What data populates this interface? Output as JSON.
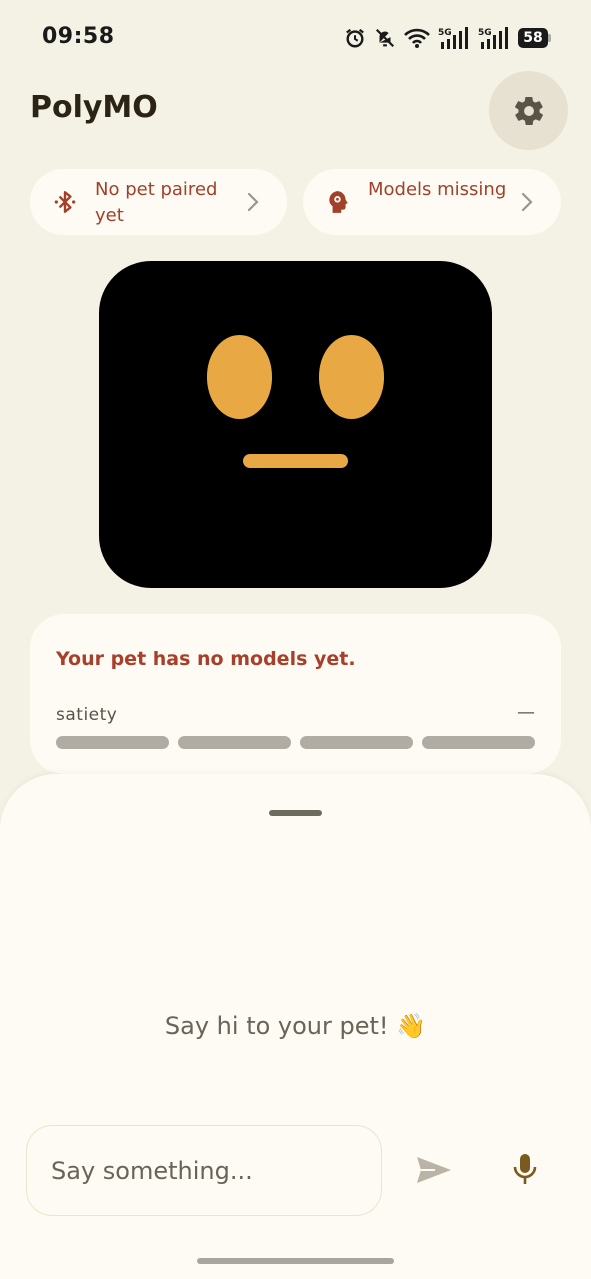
{
  "status_bar": {
    "time": "09:58",
    "battery": "58",
    "icons": [
      "alarm-icon",
      "bell-off-icon",
      "wifi-icon",
      "signal-5g-icon",
      "signal-5g-icon",
      "battery-icon"
    ]
  },
  "header": {
    "title": "PolyMO",
    "settings_icon": "gear-icon"
  },
  "chips": {
    "pet": {
      "label": "No pet paired yet",
      "icon": "bluetooth-icon"
    },
    "models": {
      "label": "Models missing",
      "icon": "brain-gear-icon"
    }
  },
  "status_card": {
    "message": "Your pet has no models yet.",
    "satiety_label": "satiety",
    "satiety_value": "—",
    "satiety_segments": 4
  },
  "chat": {
    "empty_prompt": "Say hi to your pet!",
    "empty_emoji": "👋",
    "input_placeholder": "Say something...",
    "send_icon": "send-icon",
    "mic_icon": "microphone-icon"
  },
  "colors": {
    "background": "#f4f1e5",
    "card": "#fdfbf3",
    "accent_red": "#a83f2a",
    "face_feature": "#e8a945",
    "face_screen": "#000000"
  }
}
